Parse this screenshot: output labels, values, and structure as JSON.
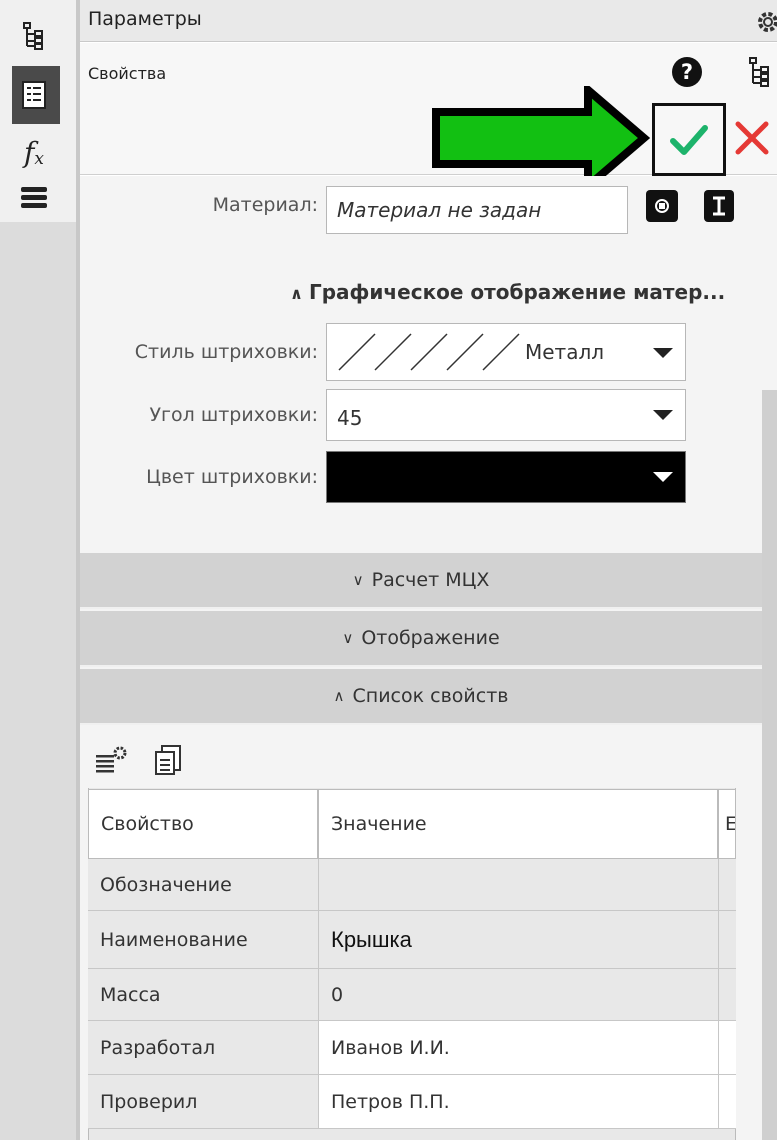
{
  "window": {
    "title": "Параметры",
    "subtitle": "Свойства"
  },
  "material": {
    "label": "Материал:",
    "value": "Материал не задан"
  },
  "hatch_section": {
    "title": "Графическое отображение матер...",
    "style_label": "Стиль штриховки:",
    "style_value": "Металл",
    "angle_label": "Угол штриховки:",
    "angle_value": "45",
    "color_label": "Цвет штриховки:",
    "color_value": "#000000"
  },
  "sections": {
    "mass": "Расчет МЦХ",
    "display": "Отображение",
    "props": "Список свойств"
  },
  "table": {
    "headers": [
      "Свойство",
      "Значение",
      "Е"
    ],
    "rows": [
      {
        "name": "Обозначение",
        "value": ""
      },
      {
        "name": "Наименование",
        "value": "Крышка"
      },
      {
        "name": "Масса",
        "value": "0"
      },
      {
        "name": "Разработал",
        "value": "Иванов И.И."
      },
      {
        "name": "Проверил",
        "value": "Петров П.П."
      }
    ]
  },
  "colors": {
    "ok_green": "#1db36b",
    "cancel_red": "#e53935",
    "arrow_green": "#12c012",
    "section_gray": "#d2d2d2"
  },
  "icons": [
    "tree-icon",
    "properties-icon",
    "fx-icon",
    "menu-icon",
    "gear-icon",
    "help-icon",
    "ok-icon",
    "cancel-icon"
  ]
}
